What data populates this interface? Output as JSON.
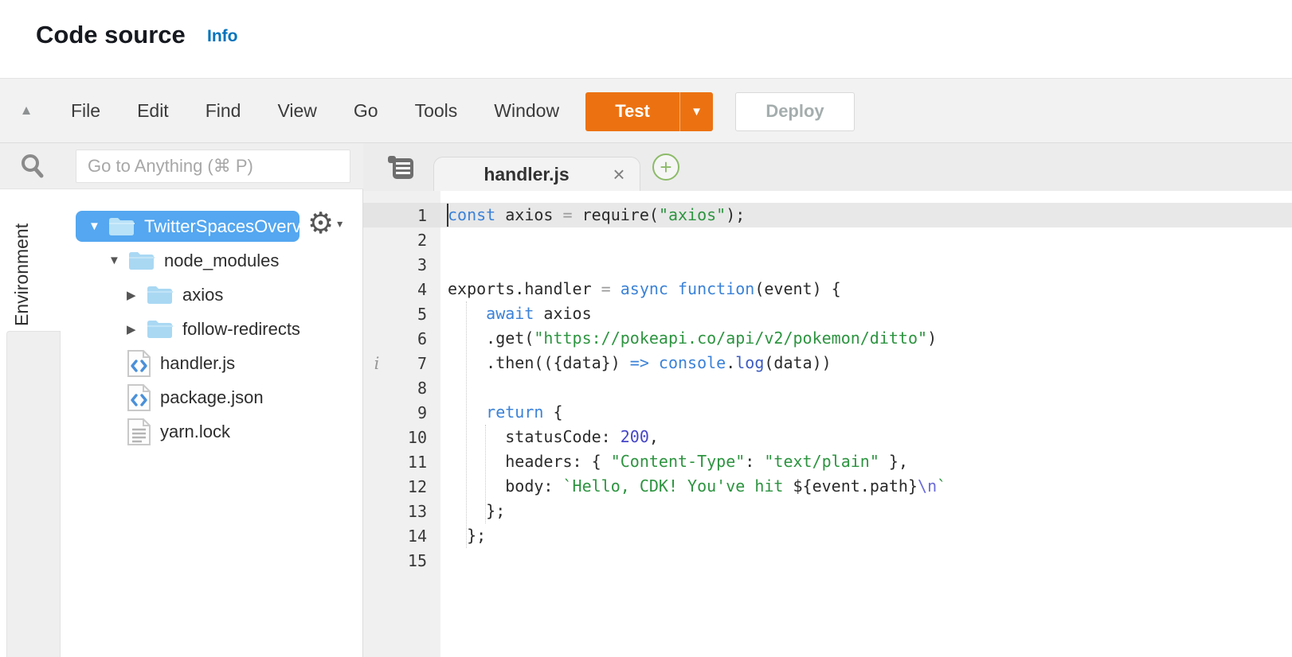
{
  "header": {
    "title": "Code source",
    "info_label": "Info"
  },
  "menubar": {
    "menus": [
      "File",
      "Edit",
      "Find",
      "View",
      "Go",
      "Tools",
      "Window"
    ],
    "test_label": "Test",
    "deploy_label": "Deploy"
  },
  "sidebar": {
    "search_placeholder": "Go to Anything (⌘ P)",
    "environment_tab": "Environment",
    "tree": [
      {
        "label": "TwitterSpacesOverv",
        "type": "folder",
        "state": "expanded",
        "indent": 0,
        "selected": true
      },
      {
        "label": "node_modules",
        "type": "folder",
        "state": "expanded",
        "indent": 1,
        "selected": false
      },
      {
        "label": "axios",
        "type": "folder",
        "state": "collapsed",
        "indent": 2,
        "selected": false
      },
      {
        "label": "follow-redirects",
        "type": "folder",
        "state": "collapsed",
        "indent": 2,
        "selected": false
      },
      {
        "label": "handler.js",
        "type": "file-code",
        "indent": 2,
        "selected": false
      },
      {
        "label": "package.json",
        "type": "file-code",
        "indent": 2,
        "selected": false
      },
      {
        "label": "yarn.lock",
        "type": "file-text",
        "indent": 2,
        "selected": false
      }
    ]
  },
  "editor": {
    "tab": {
      "name": "handler.js",
      "close_glyph": "×",
      "new_tab_glyph": "+"
    },
    "active_line": 1,
    "lines": [
      {
        "n": 1,
        "gutter_icon": "",
        "tokens": [
          {
            "s": "kw",
            "t": "const"
          },
          {
            "s": "pl",
            "t": " axios "
          },
          {
            "s": "op",
            "t": "="
          },
          {
            "s": "pl",
            "t": " require("
          },
          {
            "s": "str",
            "t": "\"axios\""
          },
          {
            "s": "pl",
            "t": ");"
          }
        ]
      },
      {
        "n": 2,
        "gutter_icon": "",
        "tokens": []
      },
      {
        "n": 3,
        "gutter_icon": "",
        "tokens": []
      },
      {
        "n": 4,
        "gutter_icon": "",
        "tokens": [
          {
            "s": "pl",
            "t": "exports.handler "
          },
          {
            "s": "op",
            "t": "="
          },
          {
            "s": "pl",
            "t": " "
          },
          {
            "s": "kw",
            "t": "async"
          },
          {
            "s": "pl",
            "t": " "
          },
          {
            "s": "kw",
            "t": "function"
          },
          {
            "s": "pl",
            "t": "(event) {"
          }
        ]
      },
      {
        "n": 5,
        "gutter_icon": "",
        "tokens": [
          {
            "s": "pl",
            "t": "    "
          },
          {
            "s": "kw",
            "t": "await"
          },
          {
            "s": "pl",
            "t": " axios"
          }
        ]
      },
      {
        "n": 6,
        "gutter_icon": "",
        "tokens": [
          {
            "s": "pl",
            "t": "    .get("
          },
          {
            "s": "str",
            "t": "\"https://pokeapi.co/api/v2/pokemon/ditto\""
          },
          {
            "s": "pl",
            "t": ")"
          }
        ]
      },
      {
        "n": 7,
        "gutter_icon": "i",
        "tokens": [
          {
            "s": "pl",
            "t": "    .then(({data}) "
          },
          {
            "s": "kw",
            "t": "=>"
          },
          {
            "s": "pl",
            "t": " "
          },
          {
            "s": "sup",
            "t": "console"
          },
          {
            "s": "pl",
            "t": "."
          },
          {
            "s": "fn",
            "t": "log"
          },
          {
            "s": "pl",
            "t": "(data))"
          }
        ]
      },
      {
        "n": 8,
        "gutter_icon": "",
        "tokens": []
      },
      {
        "n": 9,
        "gutter_icon": "",
        "tokens": [
          {
            "s": "pl",
            "t": "    "
          },
          {
            "s": "kw",
            "t": "return"
          },
          {
            "s": "pl",
            "t": " {"
          }
        ]
      },
      {
        "n": 10,
        "gutter_icon": "",
        "tokens": [
          {
            "s": "pl",
            "t": "      statusCode: "
          },
          {
            "s": "num",
            "t": "200"
          },
          {
            "s": "pl",
            "t": ","
          }
        ]
      },
      {
        "n": 11,
        "gutter_icon": "",
        "tokens": [
          {
            "s": "pl",
            "t": "      headers: { "
          },
          {
            "s": "str",
            "t": "\"Content-Type\""
          },
          {
            "s": "pl",
            "t": ": "
          },
          {
            "s": "str",
            "t": "\"text/plain\""
          },
          {
            "s": "pl",
            "t": " },"
          }
        ]
      },
      {
        "n": 12,
        "gutter_icon": "",
        "tokens": [
          {
            "s": "pl",
            "t": "      body: "
          },
          {
            "s": "str",
            "t": "`Hello, CDK! You've hit "
          },
          {
            "s": "pl",
            "t": "${event.path}"
          },
          {
            "s": "esc",
            "t": "\\n"
          },
          {
            "s": "str",
            "t": "`"
          }
        ]
      },
      {
        "n": 13,
        "gutter_icon": "",
        "tokens": [
          {
            "s": "pl",
            "t": "    };"
          }
        ]
      },
      {
        "n": 14,
        "gutter_icon": "",
        "tokens": [
          {
            "s": "pl",
            "t": "  };"
          }
        ]
      },
      {
        "n": 15,
        "gutter_icon": "",
        "tokens": []
      }
    ]
  },
  "colors": {
    "accent_orange": "#ec7211",
    "info_link_blue": "#0073bb",
    "selection_blue": "#54a7f0",
    "folder_blue": "#a9d8f3",
    "new_tab_green": "#8cbb68",
    "syntax_keyword": "#3b82d8",
    "syntax_string": "#2d9440",
    "syntax_number": "#4646c8",
    "syntax_escape": "#6a6ad8"
  }
}
